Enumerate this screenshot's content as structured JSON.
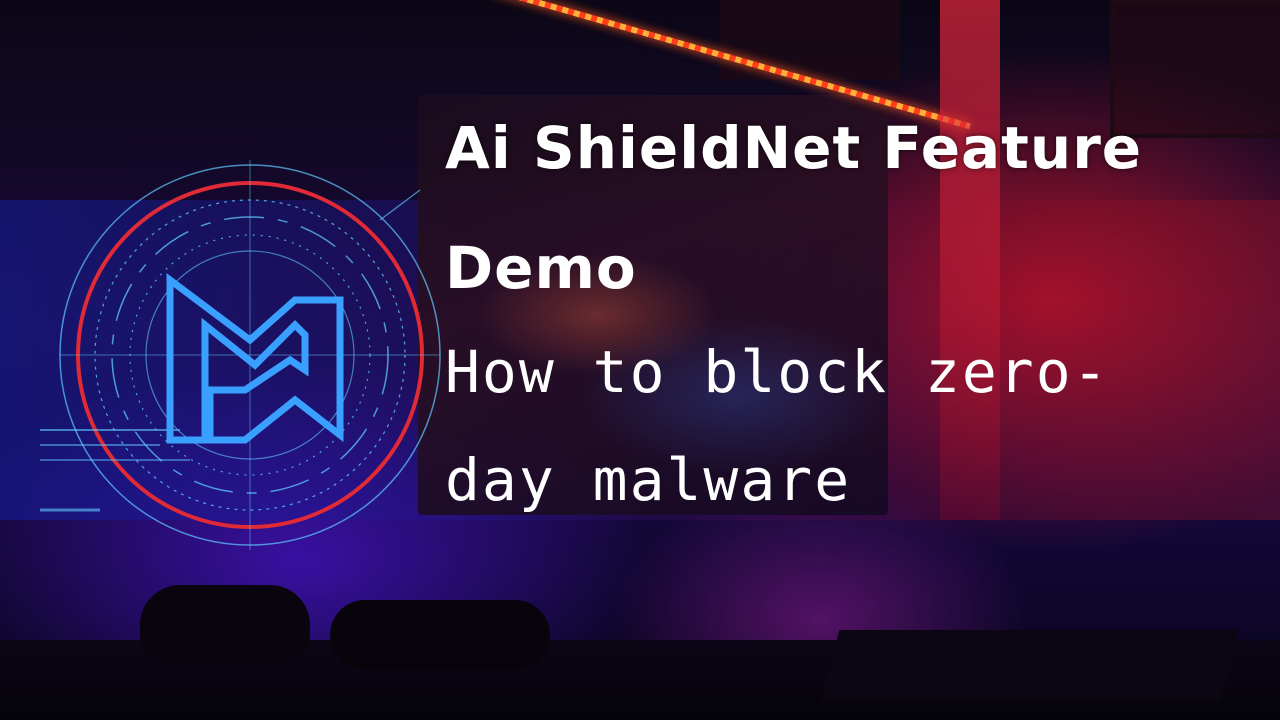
{
  "video": {
    "title_line1": "Ai ShieldNet Feature",
    "title_line2": "Demo",
    "subtitle_line1": "How to block zero-",
    "subtitle_line2": "day malware"
  },
  "colors": {
    "logo_blue": "#3aa0ff",
    "logo_ring_red": "#e02a36",
    "logo_ring_cyan": "#5fc9ff",
    "text": "#ffffff"
  },
  "icons": {
    "logo": "m1-logo-icon"
  }
}
